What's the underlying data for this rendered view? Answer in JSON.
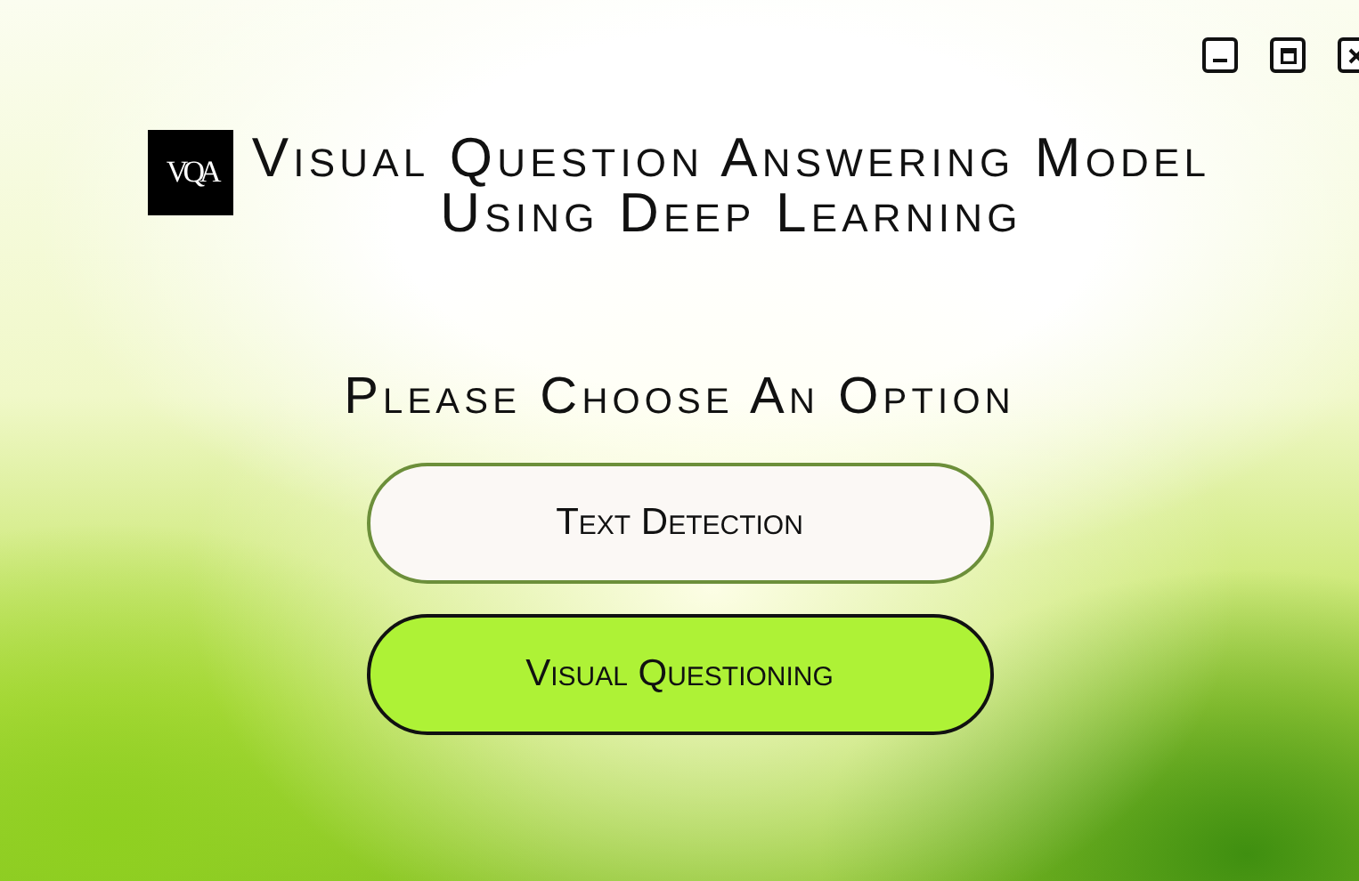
{
  "logo": {
    "text": "VQA"
  },
  "title": [
    "Visual Question Answering Model",
    "Using Deep Learning"
  ],
  "prompt": "Please Choose An Option",
  "options": [
    {
      "label": "Text Detection",
      "selected": false
    },
    {
      "label": "Visual Questioning",
      "selected": true
    }
  ],
  "window_controls": [
    {
      "kind": "minimize"
    },
    {
      "kind": "maximize"
    },
    {
      "kind": "close"
    }
  ]
}
